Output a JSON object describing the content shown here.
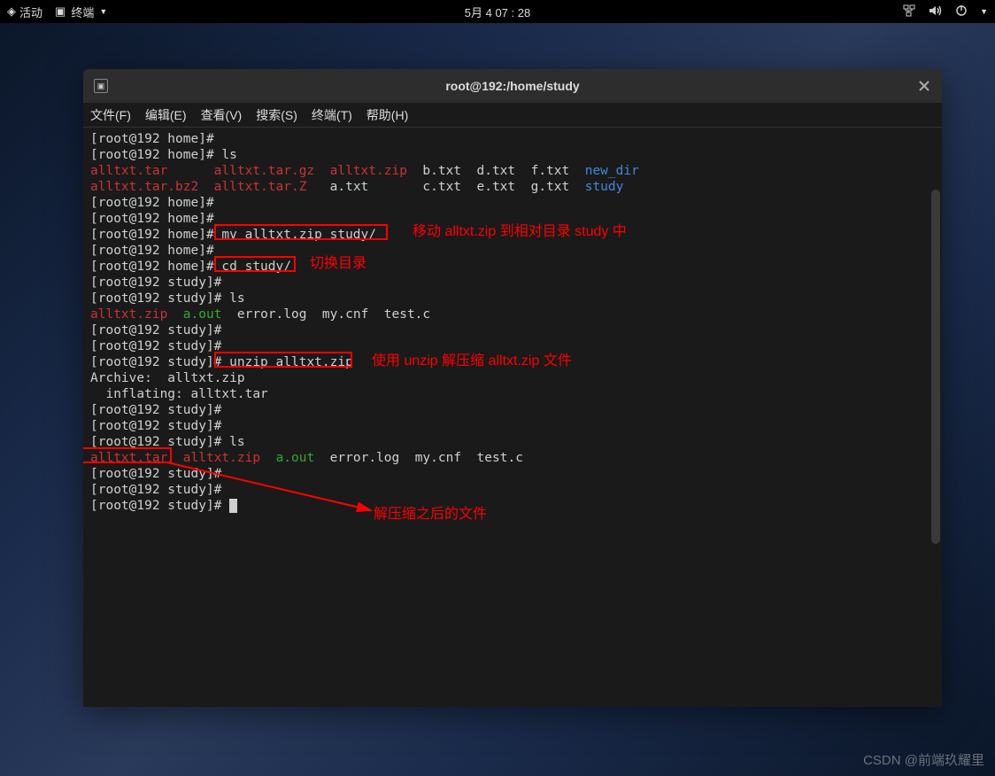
{
  "topbar": {
    "activities": "活动",
    "term_label": "终端",
    "datetime": "5月 4 07 : 28"
  },
  "window": {
    "title": "root@192:/home/study"
  },
  "menu": {
    "file": "文件(F)",
    "edit": "编辑(E)",
    "view": "查看(V)",
    "search": "搜索(S)",
    "terminal": "终端(T)",
    "help": "帮助(H)"
  },
  "prompts": {
    "home": "[root@192 home]# ",
    "study": "[root@192 study]# "
  },
  "commands": {
    "ls": "ls",
    "mv": "mv alltxt.zip study/",
    "cd": "cd study/",
    "unzip": "unzip alltxt.zip"
  },
  "output": {
    "ls1_red1": "alltxt.tar      alltxt.tar.gz  alltxt.zip",
    "ls1_white1": "  b.txt  d.txt  f.txt  ",
    "ls1_blue1": "new_dir",
    "ls1_red2": "alltxt.tar.bz2  alltxt.tar.Z",
    "ls1_white2": "   a.txt       c.txt  e.txt  g.txt  ",
    "ls1_blue2": "study",
    "ls2_red": "alltxt.zip",
    "ls2_green": "a.out",
    "ls2_white": "  error.log  my.cnf  test.c",
    "archive": "Archive:  alltxt.zip",
    "inflating": "  inflating: alltxt.tar",
    "ls3_red1": "alltxt.tar",
    "ls3_red2": "alltxt.zip",
    "ls3_green": "a.out",
    "ls3_white": "  error.log  my.cnf  test.c"
  },
  "annotations": {
    "a1": "移动 alltxt.zip 到相对目录 study 中",
    "a2": "切换目录",
    "a3": "使用 unzip 解压缩 alltxt.zip 文件",
    "a4": "解压缩之后的文件"
  },
  "watermark": "CSDN @前端玖耀里"
}
